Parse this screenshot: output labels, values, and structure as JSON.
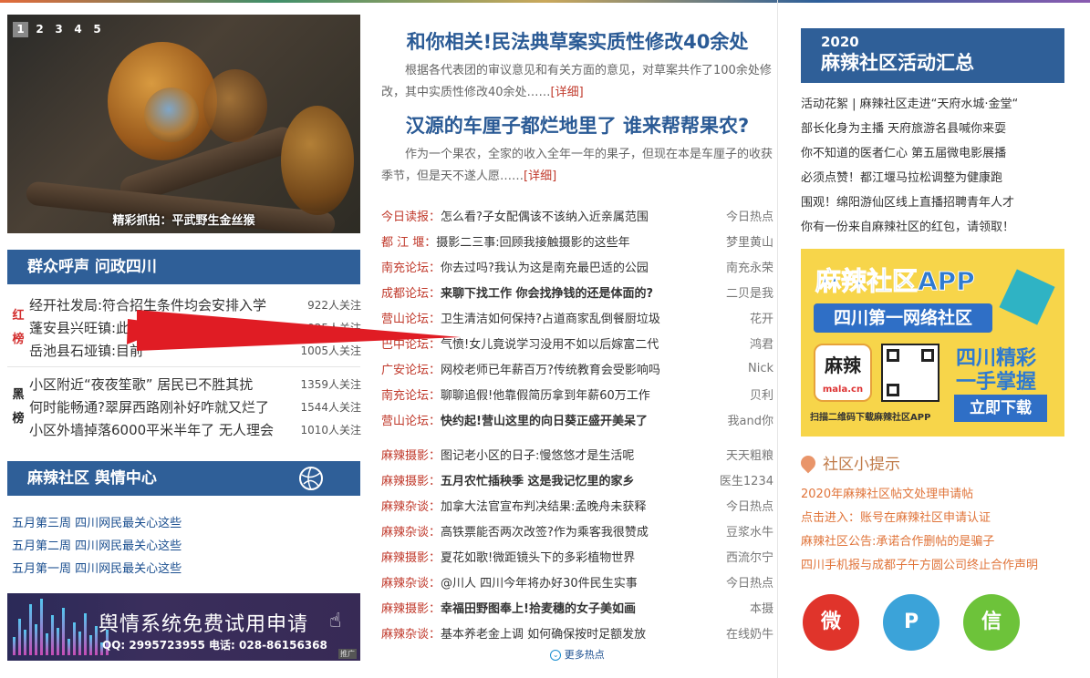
{
  "slider": {
    "pages": [
      "1",
      "2",
      "3",
      "4",
      "5"
    ],
    "active": 0,
    "caption": "精彩抓拍：平武野生金丝猴"
  },
  "appeal": {
    "title": "群众呼声 问政四川",
    "red_tag": [
      "红",
      "榜"
    ],
    "black_tag": [
      "黑",
      "榜"
    ],
    "red": [
      {
        "title": "经开社发局:符合招生条件均会安排入学",
        "count": "922人关注"
      },
      {
        "title": "蓬安县兴旺镇:此前",
        "count": "925人关注"
      },
      {
        "title": "岳池县石垭镇:目前",
        "count": "1005人关注"
      }
    ],
    "black": [
      {
        "title": "小区附近“夜夜笙歌” 居民已不胜其扰",
        "count": "1359人关注"
      },
      {
        "title": "何时能畅通?翠屏西路刚补好咋就又烂了",
        "count": "1544人关注"
      },
      {
        "title": "小区外墙掉落6000平米半年了 无人理会",
        "count": "1010人关注"
      }
    ]
  },
  "sentiment": {
    "title": "麻辣社区 舆情中心",
    "items": [
      "五月第三周 四川网民最关心这些",
      "五月第二周 四川网民最关心这些",
      "五月第一周 四川网民最关心这些"
    ]
  },
  "banner": {
    "title": "舆情系统免费试用申请",
    "contact": "QQ: 2995723955  电话: 028-86156368",
    "ad": "推广"
  },
  "headlines": [
    {
      "title": "和你相关!民法典草案实质性修改40余处",
      "summary": "根据各代表团的审议意见和有关方面的意见，对草案共作了100余处修改，其中实质性修改40余处……",
      "more": "[详细]"
    },
    {
      "title": "汉源的车厘子都烂地里了 谁来帮帮果农?",
      "summary": "作为一个果农，全家的收入全年一年的果子，但现在本是车厘子的收获季节，但是天不遂人愿……",
      "more": "[详细]"
    }
  ],
  "news_forum": [
    {
      "src": "今日读报：",
      "title": "怎么看?子女配偶该不该纳入近亲属范围",
      "author": "今日热点",
      "bold": false
    },
    {
      "src": "都 江 堰：",
      "title": "摄影二三事:回顾我接触摄影的这些年",
      "author": "梦里黄山",
      "bold": false
    },
    {
      "src": "南充论坛：",
      "title": "你去过吗?我认为这是南充最巴适的公园",
      "author": "南充永荣",
      "bold": false
    },
    {
      "src": "成都论坛：",
      "title": "来聊下找工作 你会找挣钱的还是体面的?",
      "author": "二贝是我",
      "bold": true
    },
    {
      "src": "营山论坛：",
      "title": "卫生清洁如何保持?占道商家乱倒餐厨垃圾",
      "author": "花开",
      "bold": false
    },
    {
      "src": "巴中论坛：",
      "title": "气愤!女儿竟说学习没用不如以后嫁富二代",
      "author": "鸿君",
      "bold": false
    },
    {
      "src": "广安论坛：",
      "title": "网校老师已年薪百万?传统教育会受影响吗",
      "author": "Nick",
      "bold": false
    },
    {
      "src": "南充论坛：",
      "title": "聊聊追假!他靠假简历拿到年薪60万工作",
      "author": "贝利",
      "bold": false
    },
    {
      "src": "营山论坛：",
      "title": "快约起!营山这里的向日葵正盛开美呆了",
      "author": "我and你",
      "bold": true
    }
  ],
  "news_mala": [
    {
      "src": "麻辣摄影：",
      "title": "图记老小区的日子:慢悠悠才是生活呢",
      "author": "天天粗粮",
      "bold": false
    },
    {
      "src": "麻辣摄影：",
      "title": "五月农忙插秧季 这是我记忆里的家乡",
      "author": "医生1234",
      "bold": true
    },
    {
      "src": "麻辣杂谈：",
      "title": "加拿大法官宣布判决结果:孟晚舟未获释",
      "author": "今日热点",
      "bold": false
    },
    {
      "src": "麻辣杂谈：",
      "title": "高铁票能否两次改签?作为乘客我很赞成",
      "author": "豆浆水牛",
      "bold": false
    },
    {
      "src": "麻辣摄影：",
      "title": "夏花如歌!微距镜头下的多彩植物世界",
      "author": "西流尔宁",
      "bold": false
    },
    {
      "src": "麻辣杂谈：",
      "title": "@川人 四川今年将办好30件民生实事",
      "author": "今日热点",
      "bold": false
    },
    {
      "src": "麻辣摄影：",
      "title": "幸福田野图奉上!拾麦穗的女子美如画",
      "author": "本摄",
      "bold": true
    },
    {
      "src": "麻辣杂谈：",
      "title": "基本养老金上调 如何确保按时足额发放",
      "author": "在线奶牛",
      "bold": false
    }
  ],
  "more_hot": "更多热点",
  "events": {
    "year": "2020",
    "title": "麻辣社区活动汇总",
    "items": [
      "活动花絮 | 麻辣社区走进“天府水城·金堂“",
      "部长化身为主播 天府旅游名县喊你来耍",
      "你不知道的医者仁心 第五届微电影展播",
      "必须点赞！都江堰马拉松调整为健康跑",
      "围观！绵阳游仙区线上直播招聘青年人才",
      "你有一份来自麻辣社区的红包，请领取！"
    ]
  },
  "app_ad": {
    "title": "麻辣社区APP",
    "sub": "四川第一网络社区",
    "logo": "麻辣",
    "logo_domain": "mala.cn",
    "r1": "四川精彩",
    "r2": "一手掌握",
    "download": "立即下载",
    "tip": "扫描二维码下载麻辣社区APP"
  },
  "tips": {
    "title": "社区小提示",
    "items": [
      "2020年麻辣社区帖文处理申请帖",
      "点击进入：账号在麻辣社区申请认证",
      "麻辣社区公告:承诺合作删帖的是骗子",
      "四川手机报与成都子午方圆公司终止合作声明"
    ]
  },
  "social": [
    {
      "name": "weibo-icon",
      "glyph": "微",
      "color": "#e0342b"
    },
    {
      "name": "client-icon",
      "glyph": "P",
      "color": "#3ba3d9"
    },
    {
      "name": "wechat-icon",
      "glyph": "信",
      "color": "#6dc33a"
    }
  ]
}
